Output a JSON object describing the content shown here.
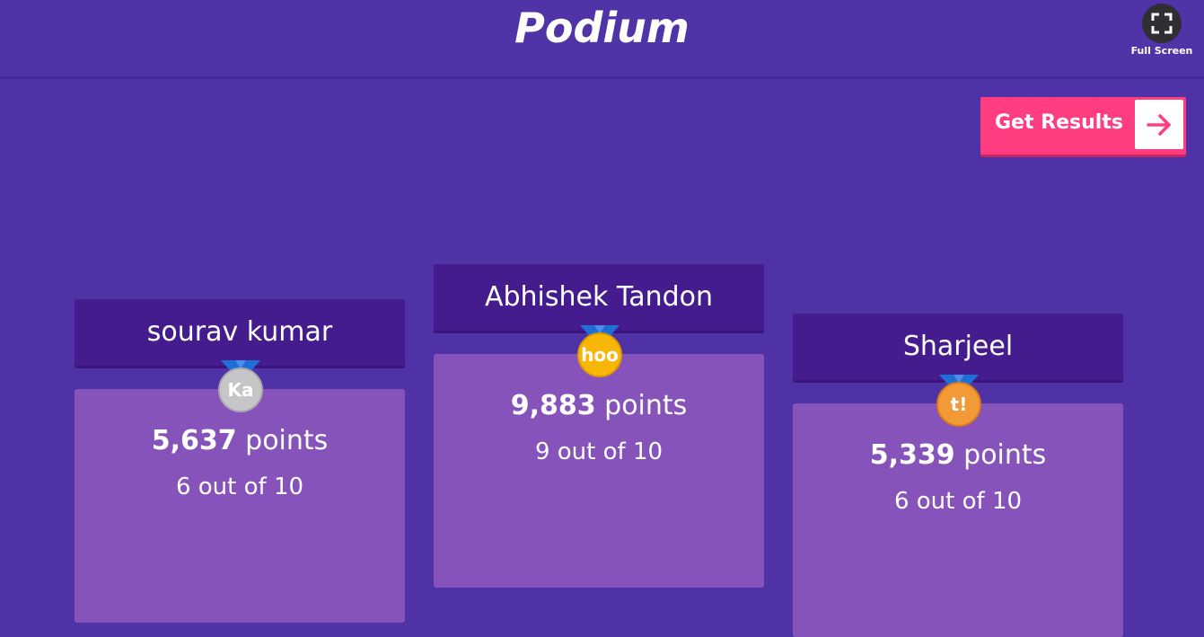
{
  "header": {
    "title": "Podium",
    "fullscreen_label": "Full Screen",
    "fullscreen_icon": "expand-icon"
  },
  "actions": {
    "get_results_label": "Get Results",
    "get_results_icon": "arrow-right-icon"
  },
  "podium": {
    "second": {
      "name": "sourav kumar",
      "points_value": "5,637",
      "points_unit": "points",
      "correct": "6 out of 10",
      "medal_text": "Ka",
      "medal": "silver-medal-icon"
    },
    "first": {
      "name": "Abhishek Tandon",
      "points_value": "9,883",
      "points_unit": "points",
      "correct": "9 out of 10",
      "medal_text": "hoo",
      "medal": "gold-medal-icon"
    },
    "third": {
      "name": "Sharjeel",
      "points_value": "5,339",
      "points_unit": "points",
      "correct": "6 out of 10",
      "medal_text": "t!",
      "medal": "bronze-medal-icon"
    }
  },
  "colors": {
    "background": "#4e32a6",
    "name_box": "#441c8e",
    "score_box": "#8653bb",
    "accent_button": "#ff3d80",
    "gold": "#f8b609",
    "silver": "#c6c6c8",
    "bronze": "#f29a38",
    "ribbon": "#1f6fd6"
  }
}
